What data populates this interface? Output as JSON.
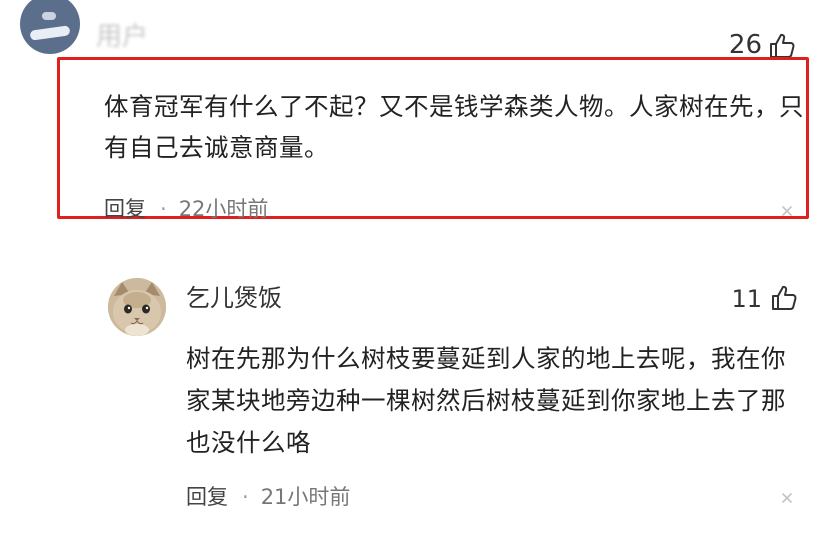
{
  "comments": [
    {
      "username": "用户",
      "like_count": "26",
      "text": "体育冠军有什么了不起？又不是钱学森类人物。人家树在先，只有自己去诚意商量。",
      "reply_label": "回复",
      "separator": "·",
      "time": "22小时前",
      "highlighted": true,
      "highlight_color": "#e02020"
    },
    {
      "username": "乞儿煲饭",
      "like_count": "11",
      "text": "树在先那为什么树枝要蔓延到人家的地上去呢，我在你家某块地旁边种一棵树然后树枝蔓延到你家地上去了那也没什么咯",
      "reply_label": "回复",
      "separator": "·",
      "time": "21小时前",
      "highlighted": false
    }
  ],
  "icons": {
    "like": "thumbs-up-icon",
    "close": "close-icon"
  }
}
